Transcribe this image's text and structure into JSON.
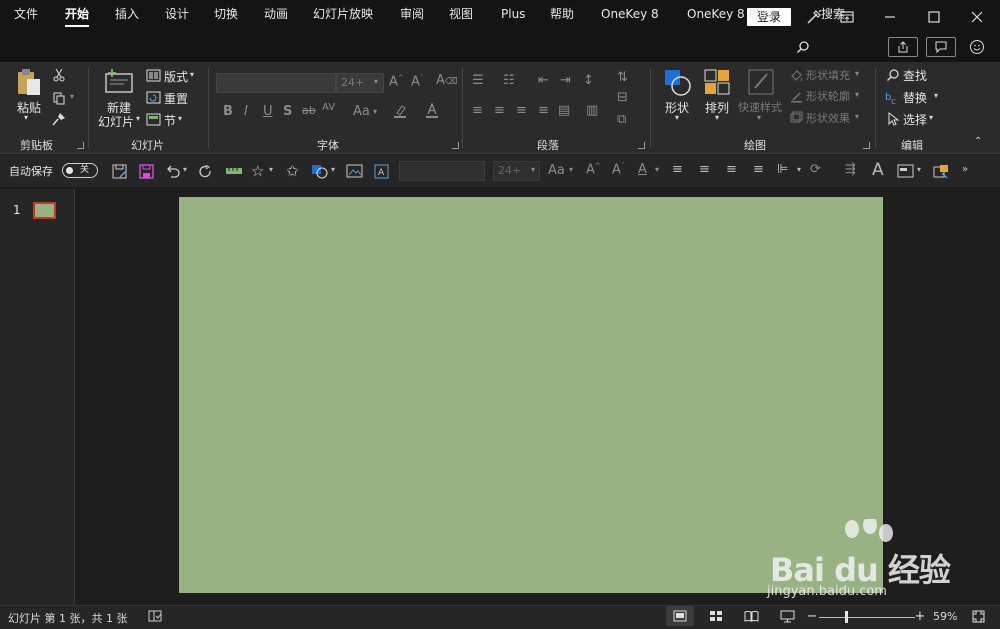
{
  "titlebar": {
    "login_label": "登录",
    "icons": [
      "wand-icon",
      "restore-ribbon-icon",
      "minimize-icon",
      "maximize-icon",
      "close-icon"
    ]
  },
  "menu": {
    "tabs": [
      "文件",
      "开始",
      "插入",
      "设计",
      "切换",
      "动画",
      "幻灯片放映",
      "审阅",
      "视图",
      "Plus",
      "帮助",
      "OneKey 8",
      "OneKey 8 Plus",
      "搜索"
    ],
    "active": "开始"
  },
  "ribbon": {
    "clipboard": {
      "paste": "粘贴",
      "label": "剪贴板"
    },
    "slides": {
      "new_slide_line1": "新建",
      "new_slide_line2": "幻灯片",
      "layout": "版式",
      "reset": "重置",
      "section": "节",
      "label": "幻灯片"
    },
    "font": {
      "size_placeholder": "24+",
      "label": "字体"
    },
    "paragraph": {
      "label": "段落"
    },
    "drawing": {
      "shapes": "形状",
      "arrange": "排列",
      "quick_styles": "快速样式",
      "shape_fill": "形状填充",
      "shape_outline": "形状轮廓",
      "shape_effects": "形状效果",
      "label": "绘图"
    },
    "editing": {
      "find": "查找",
      "replace": "替换",
      "select": "选择",
      "label": "编辑"
    }
  },
  "quick_access": {
    "autosave_label": "自动保存",
    "autosave_state": "关",
    "font_size_placeholder": "24+"
  },
  "slides_pane": {
    "slide_number": "1"
  },
  "status": {
    "slide_info": "幻灯片 第 1 张，共 1 张",
    "zoom_percent": "59%",
    "zoom_level": 0.59
  },
  "watermark": {
    "brand": "Bai du 经验",
    "url": "jingyan.baidu.com"
  },
  "colors": {
    "slide_background": "#98b283",
    "active_slide_border": "#c0392b",
    "chrome_dark": "#141414",
    "ribbon_bg": "#2b2b2b",
    "shape_blue": "#1e6fd9",
    "arrange_orange": "#e8a33d"
  }
}
